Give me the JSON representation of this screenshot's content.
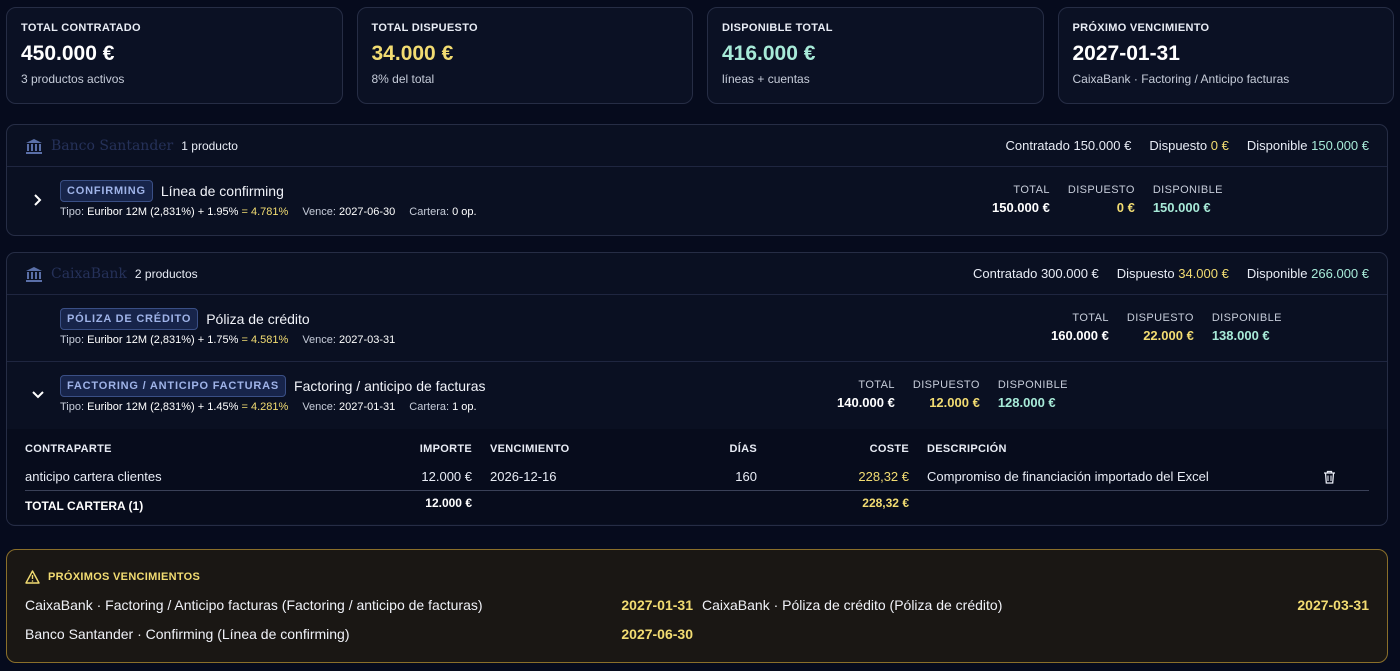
{
  "kpis": [
    {
      "label": "TOTAL CONTRATADO",
      "value": "450.000 €",
      "sub": "3 productos activos"
    },
    {
      "label": "TOTAL DISPUESTO",
      "value": "34.000 €",
      "sub": "8% del total"
    },
    {
      "label": "DISPONIBLE TOTAL",
      "value": "416.000 €",
      "sub": "líneas + cuentas"
    },
    {
      "label": "PRÓXIMO VENCIMIENTO",
      "value": "2027-01-31",
      "sub": "CaixaBank · Factoring / Anticipo facturas"
    }
  ],
  "labels": {
    "contratado": "Contratado",
    "dispuesto": "Dispuesto",
    "disponible": "Disponible",
    "total": "TOTAL",
    "dispuesto_h": "DISPUESTO",
    "disponible_h": "DISPONIBLE",
    "tipo": "Tipo:",
    "vence": "Vence:",
    "cartera": "Cartera:"
  },
  "banks": [
    {
      "name": "Banco Santander",
      "count": "1 producto",
      "contratado": "150.000 €",
      "dispuesto": "0 €",
      "disponible": "150.000 €",
      "products": [
        {
          "badge": "CONFIRMING",
          "title": "Línea de confirming",
          "rate_base": "Euribor 12M (2,831%) + 1.95%",
          "rate_total": "= 4.781%",
          "vence": "2027-06-30",
          "cartera": "0 op.",
          "total": "150.000 €",
          "dispuesto": "0 €",
          "disponible": "150.000 €"
        }
      ]
    },
    {
      "name": "CaixaBank",
      "count": "2 productos",
      "contratado": "300.000 €",
      "dispuesto": "34.000 €",
      "disponible": "266.000 €",
      "products": [
        {
          "badge": "PÓLIZA DE CRÉDITO",
          "title": "Póliza de crédito",
          "rate_base": "Euribor 12M (2,831%) + 1.75%",
          "rate_total": "= 4.581%",
          "vence": "2027-03-31",
          "total": "160.000 €",
          "dispuesto": "22.000 €",
          "disponible": "138.000 €"
        },
        {
          "badge": "FACTORING / ANTICIPO FACTURAS",
          "title": "Factoring / anticipo de facturas",
          "rate_base": "Euribor 12M (2,831%) + 1.45%",
          "rate_total": "= 4.281%",
          "vence": "2027-01-31",
          "cartera": "1 op.",
          "total": "140.000 €",
          "dispuesto": "12.000 €",
          "disponible": "128.000 €"
        }
      ]
    }
  ],
  "portfolio": {
    "headers": {
      "contraparte": "CONTRAPARTE",
      "importe": "IMPORTE",
      "vencimiento": "VENCIMIENTO",
      "dias": "DÍAS",
      "coste": "COSTE",
      "descripcion": "DESCRIPCIÓN"
    },
    "row": {
      "contraparte": "anticipo cartera clientes",
      "importe": "12.000 €",
      "vencimiento": "2026-12-16",
      "dias": "160",
      "coste": "228,32 €",
      "descripcion": "Compromiso de financiación importado del Excel"
    },
    "total_label": "TOTAL CARTERA (1)",
    "total_importe": "12.000 €",
    "total_coste": "228,32 €"
  },
  "upcoming": {
    "title": "PRÓXIMOS VENCIMIENTOS",
    "items": [
      {
        "label": "CaixaBank · Factoring / Anticipo facturas (Factoring / anticipo de facturas)",
        "date": "2027-01-31"
      },
      {
        "label": "CaixaBank · Póliza de crédito (Póliza de crédito)",
        "date": "2027-03-31"
      },
      {
        "label": "Banco Santander · Confirming (Línea de confirming)",
        "date": "2027-06-30"
      }
    ]
  },
  "colors": {
    "accent_yellow": "#f2dc72",
    "accent_mint": "#a7ead8",
    "badge_blue": "#9fb3e8"
  }
}
